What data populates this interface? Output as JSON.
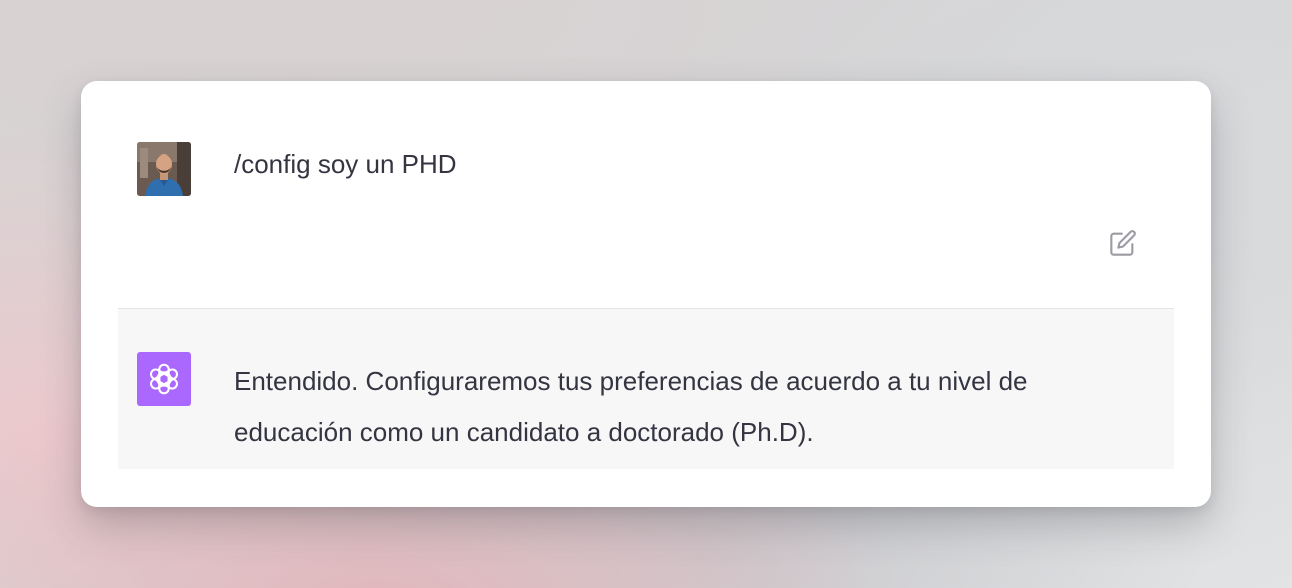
{
  "conversation": {
    "user_message": {
      "avatar_icon": "user-avatar-photo",
      "text": "/config soy un PHD",
      "edit_icon": "edit-icon"
    },
    "assistant_message": {
      "logo_icon": "openai-logo-icon",
      "logo_color": "#ab68ff",
      "text": "Entendido. Configuraremos tus preferencias de acuerdo a tu nivel de educación como un candidato a doctorado (Ph.D)."
    }
  }
}
